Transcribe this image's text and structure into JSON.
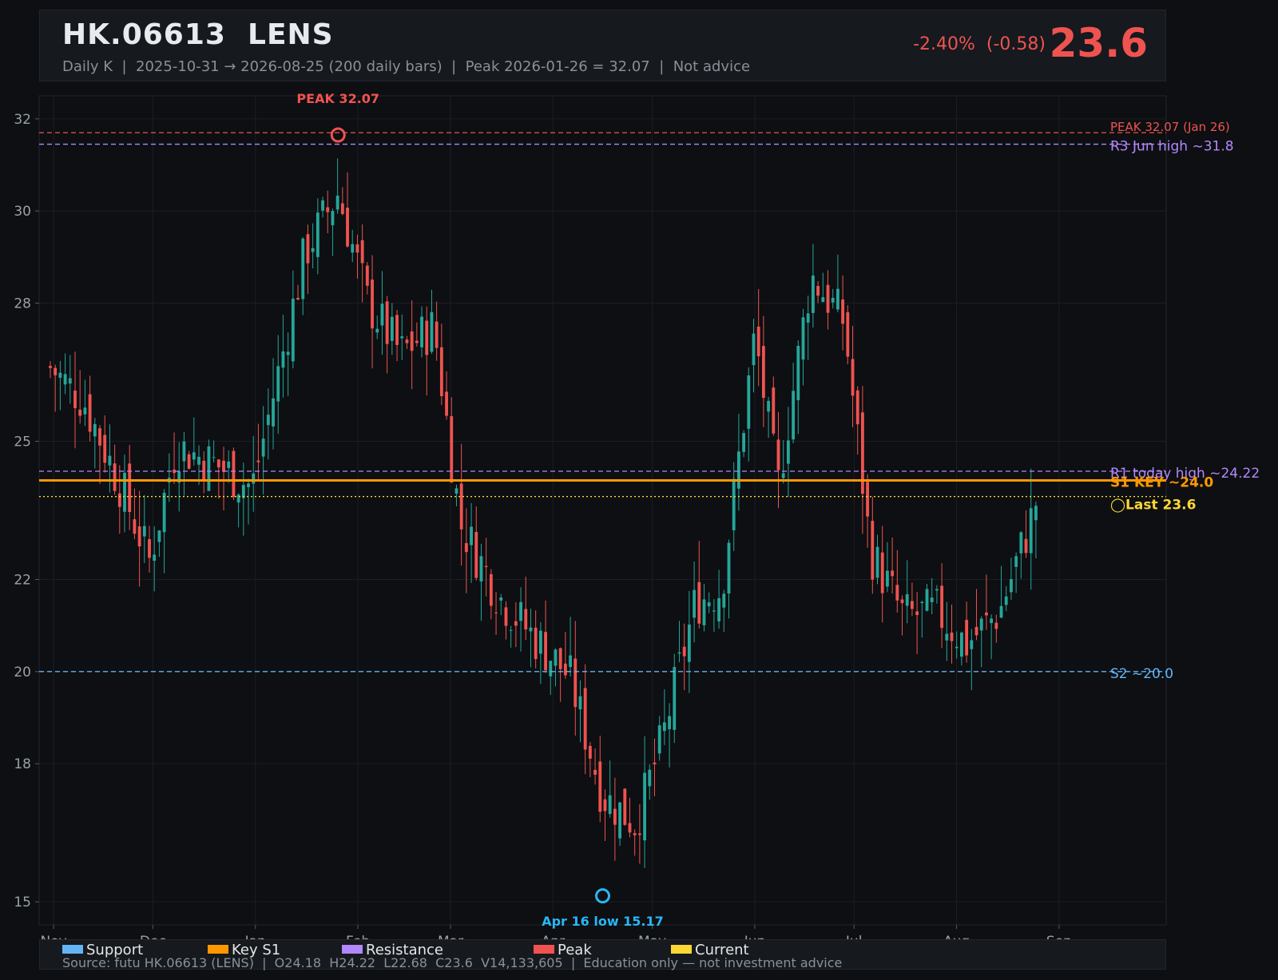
{
  "header": {
    "title": "HK.06613  LENS",
    "subtitle": "Daily K  |  2025-10-31 → 2026-08-25 (200 daily bars)  |  Peak 2026-01-26 = 32.07  |  Not advice",
    "change": "-2.40%  (-0.58)",
    "price": "23.6"
  },
  "colors": {
    "up": "#26a69a",
    "down": "#ef5350",
    "support": "#64b5f6",
    "key_s1": "#ff9800",
    "resistance": "#b388ff",
    "peak": "#ef5350",
    "current": "#fdd835"
  },
  "chart_data": {
    "type": "candlestick",
    "ylim": [
      14.5,
      32.5
    ],
    "yticks": [
      15,
      18,
      20,
      22,
      25,
      28,
      30,
      32
    ],
    "x_range": [
      "2025-10-31",
      "2026-09-30"
    ],
    "x_tick_labels": [
      "Nov",
      "Dec",
      "Jan",
      "Feb",
      "Mar",
      "Apr",
      "May",
      "Jun",
      "Jul",
      "Aug",
      "Sep"
    ],
    "x_tick_dates": [
      "2025-11-01",
      "2025-12-01",
      "2026-01-01",
      "2026-02-01",
      "2026-03-01",
      "2026-04-01",
      "2026-05-01",
      "2026-06-01",
      "2026-07-01",
      "2026-08-01",
      "2026-09-01"
    ],
    "bars": 200,
    "anchor_points": [
      {
        "date": "2025-10-31",
        "close": 26.6
      },
      {
        "date": "2025-11-10",
        "close": 25.9
      },
      {
        "date": "2025-11-22",
        "close": 23.9
      },
      {
        "date": "2025-11-30",
        "close": 22.4
      },
      {
        "date": "2025-12-08",
        "close": 24.9
      },
      {
        "date": "2025-12-20",
        "close": 24.5
      },
      {
        "date": "2025-12-31",
        "close": 24.0
      },
      {
        "date": "2026-01-08",
        "close": 26.5
      },
      {
        "date": "2026-01-16",
        "close": 29.1
      },
      {
        "date": "2026-01-26",
        "close": 30.4
      },
      {
        "date": "2026-02-04",
        "close": 28.0
      },
      {
        "date": "2026-02-14",
        "close": 26.9
      },
      {
        "date": "2026-02-24",
        "close": 27.5
      },
      {
        "date": "2026-03-04",
        "close": 23.2
      },
      {
        "date": "2026-03-16",
        "close": 21.6
      },
      {
        "date": "2026-03-28",
        "close": 20.6
      },
      {
        "date": "2026-04-06",
        "close": 19.9
      },
      {
        "date": "2026-04-16",
        "close": 17.3
      },
      {
        "date": "2026-04-26",
        "close": 16.7
      },
      {
        "date": "2026-05-04",
        "close": 18.5
      },
      {
        "date": "2026-05-14",
        "close": 21.5
      },
      {
        "date": "2026-05-22",
        "close": 21.8
      },
      {
        "date": "2026-06-01",
        "close": 27.3
      },
      {
        "date": "2026-06-08",
        "close": 24.0
      },
      {
        "date": "2026-06-18",
        "close": 28.6
      },
      {
        "date": "2026-06-28",
        "close": 27.6
      },
      {
        "date": "2026-07-06",
        "close": 22.6
      },
      {
        "date": "2026-07-16",
        "close": 21.2
      },
      {
        "date": "2026-07-26",
        "close": 21.3
      },
      {
        "date": "2026-08-04",
        "close": 20.6
      },
      {
        "date": "2026-08-14",
        "close": 21.3
      },
      {
        "date": "2026-08-25",
        "close": 23.6
      }
    ],
    "levels": [
      {
        "label": "PEAK 32.07 (Jan 26)",
        "value": 31.7,
        "color": "#ef5350",
        "style": "dashed",
        "kind": "peak"
      },
      {
        "label": "R3 Jun high ~31.8",
        "value": 31.45,
        "color": "#b388ff",
        "style": "dashed",
        "kind": "resistance"
      },
      {
        "label": "R1 today high ~24.22",
        "value": 24.35,
        "color": "#b388ff",
        "style": "dashed",
        "kind": "resistance"
      },
      {
        "label": "S1 KEY ~24.0",
        "value": 24.15,
        "color": "#ff9800",
        "style": "solid",
        "kind": "key"
      },
      {
        "label": "◯Last 23.6",
        "value": 23.8,
        "color": "#fdd835",
        "style": "dotted",
        "kind": "current"
      },
      {
        "label": "S2 ~20.0",
        "value": 20.0,
        "color": "#64b5f6",
        "style": "dashed",
        "kind": "support"
      }
    ],
    "annotations": [
      {
        "text": "PEAK 32.07",
        "date": "2026-01-26",
        "value": 31.65,
        "color": "#ef5350"
      },
      {
        "text": "Apr 16 low 15.17",
        "date": "2026-04-16",
        "value": 15.13,
        "color": "#29b6f6"
      }
    ]
  },
  "legend": {
    "items": [
      {
        "label": "Support",
        "color": "#64b5f6"
      },
      {
        "label": "Key S1",
        "color": "#ff9800"
      },
      {
        "label": "Resistance",
        "color": "#b388ff"
      },
      {
        "label": "Peak",
        "color": "#ef5350"
      },
      {
        "label": "Current",
        "color": "#fdd835"
      }
    ],
    "source": "Source: futu HK.06613 (LENS)  |  O24.18  H24.22  L22.68  C23.6  V14,133,605  |  Education only — not investment advice"
  }
}
